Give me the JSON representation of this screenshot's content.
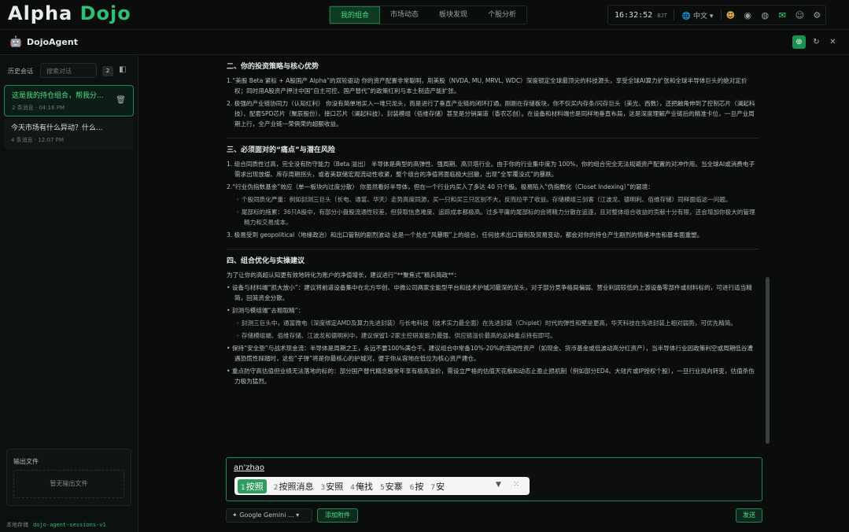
{
  "app": {
    "logo_a": "Alpha",
    "logo_b": "Dojo"
  },
  "nav": {
    "tabs": [
      "我的组合",
      "市场动态",
      "板块发现",
      "个股分析"
    ]
  },
  "status": {
    "time": "16:32:52",
    "tz": "BJT",
    "lang": "中文"
  },
  "agent": {
    "name": "DojoAgent"
  },
  "sidebar": {
    "history_label": "历史会话",
    "search_placeholder": "搜索对话",
    "count": "2",
    "sessions": [
      {
        "title": "这是我的持仓组合，帮我分...",
        "meta": "2 条消息 · 04:16 PM"
      },
      {
        "title": "今天市场有什么异动？什么...",
        "meta": "4 条消息 · 12:07 PM"
      }
    ],
    "output_title": "输出文件",
    "output_empty": "暂无输出文件",
    "local_label": "本地存储",
    "local_key": "dojo-agent-sessions-v1"
  },
  "content": {
    "s2": {
      "title": "二、你的投资策略与核心优势",
      "p1": "1.“美股 Beta 紧标 + A股国产 Alpha”的双轮驱动 你的资产配置非常聪明，用美股（NVDA, MU, MRVL, WDC）深度锁定全球最顶尖的科技源头，享受全球AI算力扩张和全球半导体巨头的绝对定价权；同时用A股资产押注中国“自主可控、国产替代”的政策红利与本土制造产能扩张。",
      "p2": "2. 极强的产业链协同力（认知红利） 你没有简单地买入一堆只龙头，而是进行了垂直产业链的闭环打通。刚刚在存储板块，你不仅买内存条/闪存巨头（美光、西数），还把触角伸到了控制芯片（澜起科技）、配套SPD芯片（聚辰股份）、接口芯片（澜起科技）、封装模组（佰维存储）甚至是分销渠道（香农芯创）。在设备和材料端也是同样地垂直布局，这是深度理解产业链后的精准卡位，一旦产业周期上行，全产业链一荣俱荣的超额收益。"
    },
    "s3": {
      "title": "三、必须面对的“痛点”与潜在风险",
      "p1": "1. 组合同质性过高，完全没有防守能力（Beta 溢出） 半导体是典型的高弹性、强周期、高贝塔行业。由于你的行业集中度为 100%，你的组合完全无法规避资产配置的对冲作用。当全球AI或消费电子需求出现放缓、库存周期拐头，或者美联储宏观流动性收紧，整个组合的净值将面临极大回撤，出现“全军覆没式”的暴跌。",
      "p2": "2.“行业伪指数基金”效应（单一板块内过度分散） 你虽然看好半导体，但在一个行业内买入了多达 40 只个股。极易陷入“伪指数化（Closet Indexing）”的窘境：",
      "sub1": "◦ 个股同质化严重：例如封测三巨头（长电、通富、华天）走势高度同源，买一只和买三只区别不大，反而拉平了收益。存储模组三剑客（江波龙、德明利、佰维存储）同样面临这一问题。",
      "sub2": "◦ 尾部标的拖累：36只A股中，有部分小盘股流通性较差，但获取信息难度、追踪成本都极高。过多平庸的尾部标的会将精力分散在追逐，且对整体组合收益的贡献十分有限，还会增加你极大的管理精力和交易成本。",
      "p3": "3. 极易受到 geopolitical（地缘政治）和出口管制的剧烈波动 这是一个处在“风暴眼”上的组合，任何技术出口管制及贸易变动，都会对你的持仓产生剧烈的情绪冲击和基本面重塑。"
    },
    "s4": {
      "title": "四、组合优化与实操建议",
      "intro": "为了让你的高超认知更有效地转化为账户的净值增长，建议进行“**聚焦式”精兵简政**：",
      "p1": "• 设备与材料端“抓大放小”：建议将前道设备集中在北方华创、中微公司两家全能型平台和技术护城河最深的龙头，对于部分竞争格局偏弱、营业利润较低的上游设备零部件或材料标的，可进行适当精简，回笼资金分散。",
      "p2": "• 封测与模组端“去粗取精”：",
      "sub1": "◦ 封测三巨头中，通富微电（深度绑定AMD及算力先进封装）与长电科技（技术实力最全面）在先进封装（Chiplet）时代的弹性和壁垒更高，华天科技在先进封装上相对弱势，可优先精简。",
      "sub2": "◦ 存储模组端、佰维存储、江波龙和德明利中，建议保留1-2家主控研发能力最强、供应链溢价最高的品种重点持有即可。",
      "p3": "• 保持“安全垫”与战术现金流：半导体是周期之王，永远不要100%满仓干。建议组合中常备10%-20%的流动性资产（如现金、货币基金或低波动高分红资产），当半导体行业因政策利空或周期低谷遭遇恐慌性踩踏时，这些“子弹”将是你最核心的护城河，便于你从容地在低位为核心资产建仓。",
      "p4": "• 重点防守高估值但业绩无法落地的标的：部分国产替代概念股常年享有极高溢价，需设立严格的估值天花板和动态止盈止损机制（例如部分ED4、大硅片或IP授权个股），一旦行业风向转变，估值杀伤力极为猛烈。"
    }
  },
  "composer": {
    "typed": "an'zhao",
    "candidates": [
      {
        "n": "1",
        "w": "按照"
      },
      {
        "n": "2",
        "w": "按照消息"
      },
      {
        "n": "3",
        "w": "安照"
      },
      {
        "n": "4",
        "w": "俺找"
      },
      {
        "n": "5",
        "w": "安寨"
      },
      {
        "n": "6",
        "w": "按"
      },
      {
        "n": "7",
        "w": "安"
      }
    ],
    "model": "Google Gemini ...",
    "attach": "添加附件",
    "send": "发送"
  },
  "colors": {
    "accent": "#2fbf71",
    "bg": "#0b0d0d"
  }
}
